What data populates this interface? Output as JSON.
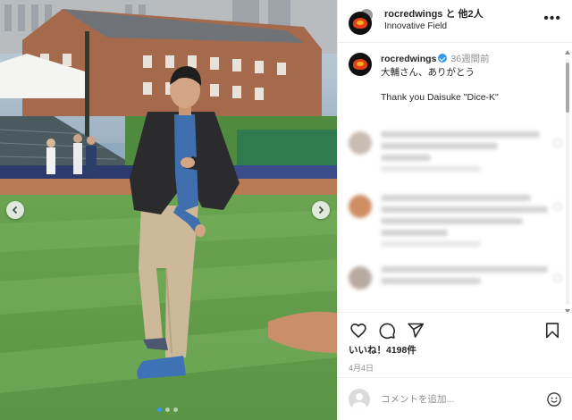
{
  "header": {
    "username": "rocredwings",
    "with_others": "と 他2人",
    "location": "Innovative Field",
    "more_label": "•••"
  },
  "caption": {
    "username": "rocredwings",
    "time": "36週間前",
    "line_jp": "大輔さん、ありがとう",
    "line_en": "Thank you Daisuke \"Dice-K\""
  },
  "post": {
    "likes": "いいね！4198件",
    "date": "4月4日"
  },
  "comment_box": {
    "placeholder": "コメントを追加..."
  },
  "carousel": {
    "slide_count": 3,
    "active_index": 0
  },
  "icons": {
    "like": "heart-icon",
    "comment": "comment-bubble-icon",
    "share": "paper-plane-icon",
    "save": "bookmark-icon",
    "emoji": "smiley-icon",
    "prev": "chevron-left-icon",
    "next": "chevron-right-icon"
  },
  "colors": {
    "verified": "#3897f0",
    "text": "#262626",
    "muted": "#8e8e8e",
    "grass": "#5f9a48",
    "dirt": "#b97a56"
  }
}
